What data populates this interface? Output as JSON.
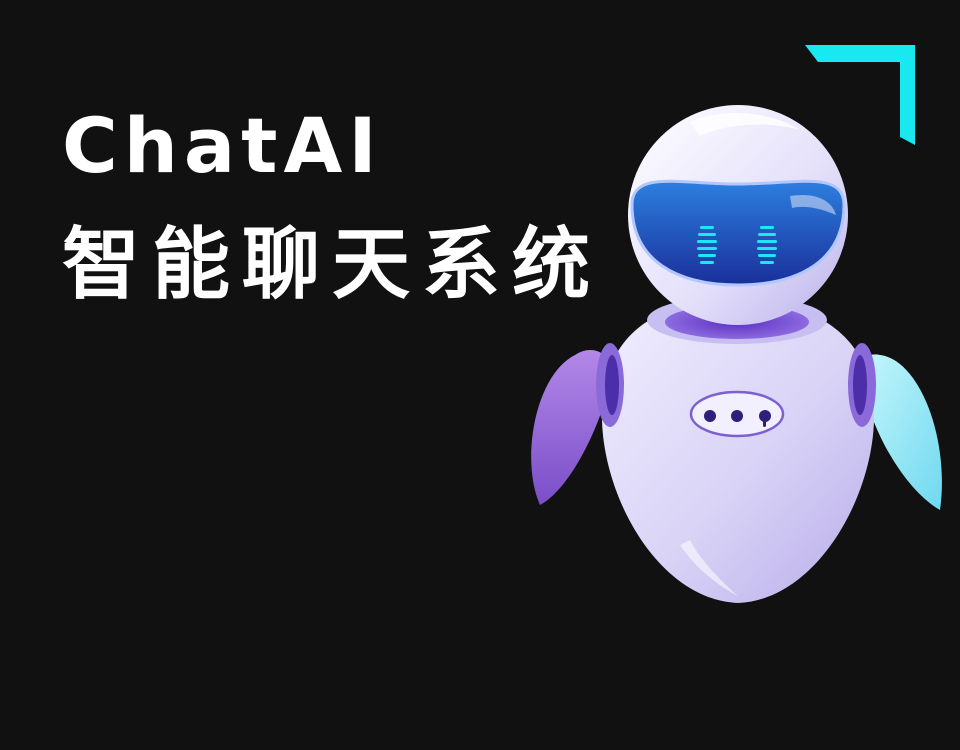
{
  "headline": {
    "title": "ChatAI",
    "subtitle": "智能聊天系统"
  },
  "illustration": {
    "subject": "robot-mascot-icon",
    "accent_color": "#19e8f0",
    "visor_color": "#1a5ec2",
    "body_color": "#dcd6f7",
    "left_arm_color": "#9a67d6",
    "right_arm_color": "#8fe8f5"
  },
  "decoration": {
    "corner_bracket_icon": "corner-bracket-icon",
    "corner_bracket_color": "#19e8f0"
  },
  "background_color": "#111111"
}
